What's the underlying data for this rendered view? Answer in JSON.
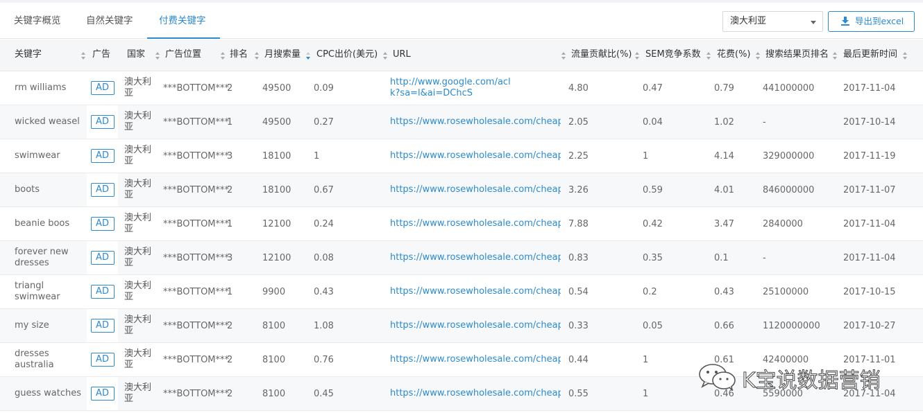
{
  "tabs": [
    "关键字概览",
    "自然关键字",
    "付费关键字"
  ],
  "active_tab": 2,
  "country_select": {
    "value": "澳大利亚"
  },
  "export_button": {
    "label": "导出到excel"
  },
  "columns": {
    "keyword": "关键字",
    "ad": "广告",
    "country": "国家",
    "ad_position": "广告位置",
    "rank": "排名",
    "monthly_searches": "月搜索量",
    "cpc": "CPC出价(美元)",
    "url": "URL",
    "traffic_share": "流量贡献比(%)",
    "sem_competition": "SEM竞争系数",
    "cost": "花费(%)",
    "serp_results": "搜索结果页排名",
    "last_updated": "最后更新时间"
  },
  "rows": [
    {
      "keyword": "rm williams",
      "ad": "AD",
      "country": "澳大利亚",
      "ad_position": "***BOTTOM***",
      "rank": "2",
      "monthly_searches": "49500",
      "cpc": "0.09",
      "url": "http://www.google.com/aclk?sa=l&ai=DChcS",
      "traffic_share": "4.80",
      "sem_competition": "0.47",
      "cost": "0.79",
      "serp_results": "441000000",
      "last_updated": "2017-11-04"
    },
    {
      "keyword": "wicked weasel",
      "ad": "AD",
      "country": "澳大利亚",
      "ad_position": "***BOTTOM***",
      "rank": "1",
      "monthly_searches": "49500",
      "cpc": "0.27",
      "url": "https://www.rosewholesale.com/cheap-onli",
      "traffic_share": "2.05",
      "sem_competition": "0.04",
      "cost": "1.02",
      "serp_results": "-",
      "last_updated": "2017-10-14"
    },
    {
      "keyword": "swimwear",
      "ad": "AD",
      "country": "澳大利亚",
      "ad_position": "***BOTTOM***",
      "rank": "3",
      "monthly_searches": "18100",
      "cpc": "1",
      "url": "https://www.rosewholesale.com/cheap-onli",
      "traffic_share": "2.25",
      "sem_competition": "1",
      "cost": "4.14",
      "serp_results": "329000000",
      "last_updated": "2017-11-19"
    },
    {
      "keyword": "boots",
      "ad": "AD",
      "country": "澳大利亚",
      "ad_position": "***BOTTOM***",
      "rank": "2",
      "monthly_searches": "18100",
      "cpc": "0.67",
      "url": "https://www.rosewholesale.com/cheap-onli",
      "traffic_share": "3.26",
      "sem_competition": "0.59",
      "cost": "4.01",
      "serp_results": "846000000",
      "last_updated": "2017-11-07"
    },
    {
      "keyword": "beanie boos",
      "ad": "AD",
      "country": "澳大利亚",
      "ad_position": "***BOTTOM***",
      "rank": "1",
      "monthly_searches": "12100",
      "cpc": "0.24",
      "url": "https://www.rosewholesale.com/cheap/bean",
      "traffic_share": "7.88",
      "sem_competition": "0.42",
      "cost": "3.47",
      "serp_results": "2840000",
      "last_updated": "2017-11-04"
    },
    {
      "keyword": "forever new dresses",
      "ad": "AD",
      "country": "澳大利亚",
      "ad_position": "***BOTTOM***",
      "rank": "3",
      "monthly_searches": "12100",
      "cpc": "0.08",
      "url": "https://www.rosewholesale.com/cheap-onli",
      "traffic_share": "0.83",
      "sem_competition": "0.35",
      "cost": "0.1",
      "serp_results": "-",
      "last_updated": "2017-11-04"
    },
    {
      "keyword": "triangl swimwear",
      "ad": "AD",
      "country": "澳大利亚",
      "ad_position": "***BOTTOM***",
      "rank": "1",
      "monthly_searches": "9900",
      "cpc": "0.43",
      "url": "https://www.rosewholesale.com/cheap-onli",
      "traffic_share": "0.54",
      "sem_competition": "0.2",
      "cost": "0.43",
      "serp_results": "25100000",
      "last_updated": "2017-10-15"
    },
    {
      "keyword": "my size",
      "ad": "AD",
      "country": "澳大利亚",
      "ad_position": "***BOTTOM***",
      "rank": "2",
      "monthly_searches": "8100",
      "cpc": "1.08",
      "url": "https://www.rosewholesale.com/cheap-onli",
      "traffic_share": "0.33",
      "sem_competition": "0.05",
      "cost": "0.66",
      "serp_results": "1120000000",
      "last_updated": "2017-10-27"
    },
    {
      "keyword": "dresses australia",
      "ad": "AD",
      "country": "澳大利亚",
      "ad_position": "***BOTTOM***",
      "rank": "2",
      "monthly_searches": "8100",
      "cpc": "0.76",
      "url": "https://www.rosewholesale.com/cheap-onli",
      "traffic_share": "0.44",
      "sem_competition": "1",
      "cost": "0.61",
      "serp_results": "42400000",
      "last_updated": "2017-11-01"
    },
    {
      "keyword": "guess watches",
      "ad": "AD",
      "country": "澳大利亚",
      "ad_position": "***BOTTOM***",
      "rank": "2",
      "monthly_searches": "8100",
      "cpc": "0.45",
      "url": "https://www.rosewholesale.com/cheap-onli",
      "traffic_share": "0.55",
      "sem_competition": "1",
      "cost": "0.46",
      "serp_results": "5590000",
      "last_updated": "2017-11-04"
    }
  ],
  "watermark": {
    "text": "K宝说数据营销"
  },
  "colors": {
    "accent": "#2a8ad4",
    "header_bg": "#f5f6f7",
    "row_alt_bg": "#f7f8f9"
  },
  "icons": {
    "export": "download-icon",
    "watermark": "wechat-icon"
  }
}
